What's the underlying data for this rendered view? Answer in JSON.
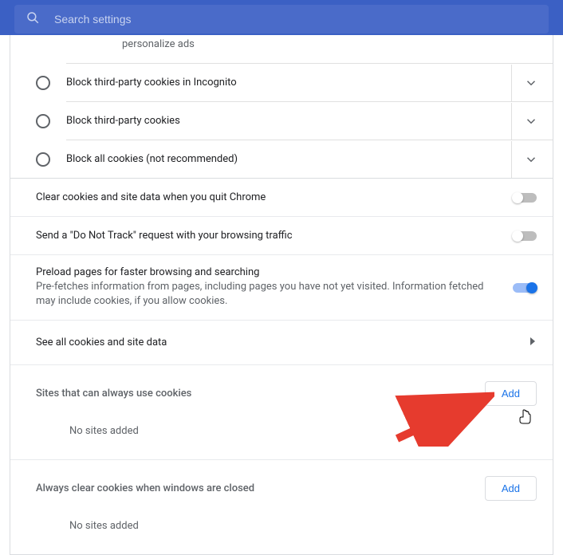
{
  "search": {
    "placeholder": "Search settings"
  },
  "partial_text": "personalize ads",
  "radios": {
    "incognito": "Block third-party cookies in Incognito",
    "third_party": "Block third-party cookies",
    "all": "Block all cookies (not recommended)"
  },
  "toggles": {
    "clear_on_quit": {
      "title": "Clear cookies and site data when you quit Chrome",
      "on": false
    },
    "do_not_track": {
      "title": "Send a \"Do Not Track\" request with your browsing traffic",
      "on": false
    },
    "preload": {
      "title": "Preload pages for faster browsing and searching",
      "sub": "Pre-fetches information from pages, including pages you have not yet visited. Information fetched may include cookies, if you allow cookies.",
      "on": true
    }
  },
  "see_all": "See all cookies and site data",
  "sections": {
    "always_allow": {
      "title": "Sites that can always use cookies",
      "add": "Add",
      "empty": "No sites added"
    },
    "always_clear": {
      "title": "Always clear cookies when windows are closed",
      "add": "Add",
      "empty": "No sites added"
    }
  }
}
